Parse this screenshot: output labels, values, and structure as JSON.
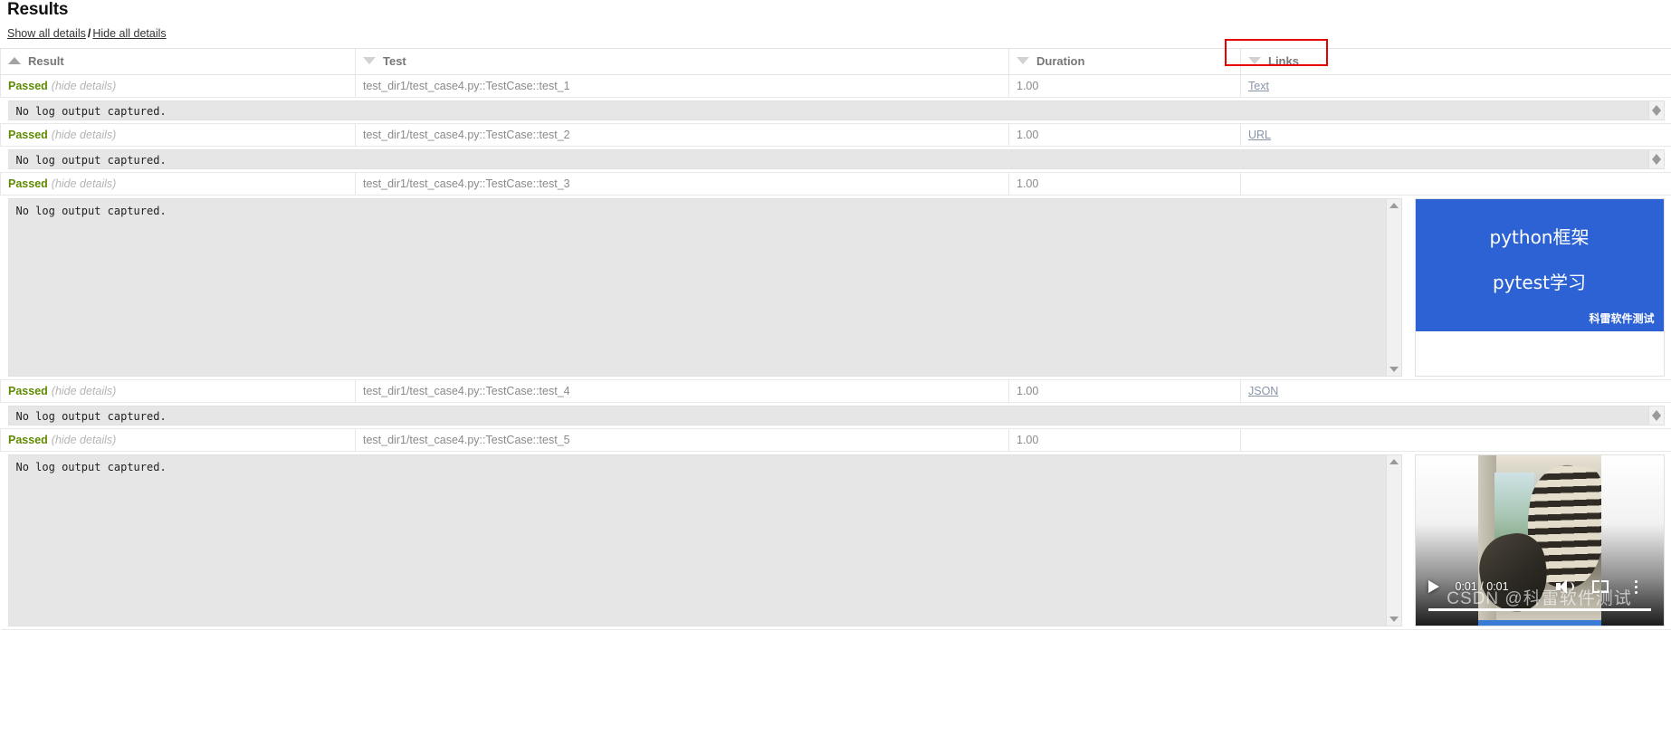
{
  "header": {
    "title": "Results",
    "show_all_details": "Show all details",
    "separator": "/",
    "hide_all_details": "Hide all details"
  },
  "table": {
    "columns": [
      {
        "label": "Result",
        "sort": "asc",
        "icon": "sort-asc-icon"
      },
      {
        "label": "Test",
        "sort": "desc",
        "icon": "sort-desc-icon"
      },
      {
        "label": "Duration",
        "sort": "desc",
        "icon": "sort-desc-icon"
      },
      {
        "label": "Links",
        "sort": "desc",
        "icon": "sort-desc-icon"
      }
    ],
    "rows": [
      {
        "result": "Passed",
        "details_toggle": "(hide details)",
        "test": "test_dir1/test_case4.py::TestCase::test_1",
        "duration": "1.00",
        "link": "Text",
        "log": "No log output captured.",
        "log_size": "short",
        "attachment": "none"
      },
      {
        "result": "Passed",
        "details_toggle": "(hide details)",
        "test": "test_dir1/test_case4.py::TestCase::test_2",
        "duration": "1.00",
        "link": "URL",
        "log": "No log output captured.",
        "log_size": "short",
        "attachment": "none"
      },
      {
        "result": "Passed",
        "details_toggle": "(hide details)",
        "test": "test_dir1/test_case4.py::TestCase::test_3",
        "duration": "1.00",
        "link": "",
        "log": "No log output captured.",
        "log_size": "tall",
        "attachment": "image"
      },
      {
        "result": "Passed",
        "details_toggle": "(hide details)",
        "test": "test_dir1/test_case4.py::TestCase::test_4",
        "duration": "1.00",
        "link": "JSON",
        "log": "No log output captured.",
        "log_size": "short",
        "attachment": "none"
      },
      {
        "result": "Passed",
        "details_toggle": "(hide details)",
        "test": "test_dir1/test_case4.py::TestCase::test_5",
        "duration": "1.00",
        "link": "",
        "log": "No log output captured.",
        "log_size": "tall2",
        "attachment": "video"
      }
    ]
  },
  "attachments": {
    "image": {
      "line1": "python框架",
      "line2": "pytest学习",
      "watermark": "科雷软件测试",
      "background_color": "#2d62d4"
    },
    "video": {
      "current_time": "0:01",
      "duration": "0:01",
      "time_display": "0:01 / 0:01",
      "watermark": "CSDN @科雷软件测试"
    }
  },
  "annotation": {
    "target": "Links",
    "color": "#e60000"
  },
  "colors": {
    "passed": "#5f8a00",
    "link": "#8794a8",
    "log_background": "#e6e6e6",
    "annotation": "#e60000"
  }
}
